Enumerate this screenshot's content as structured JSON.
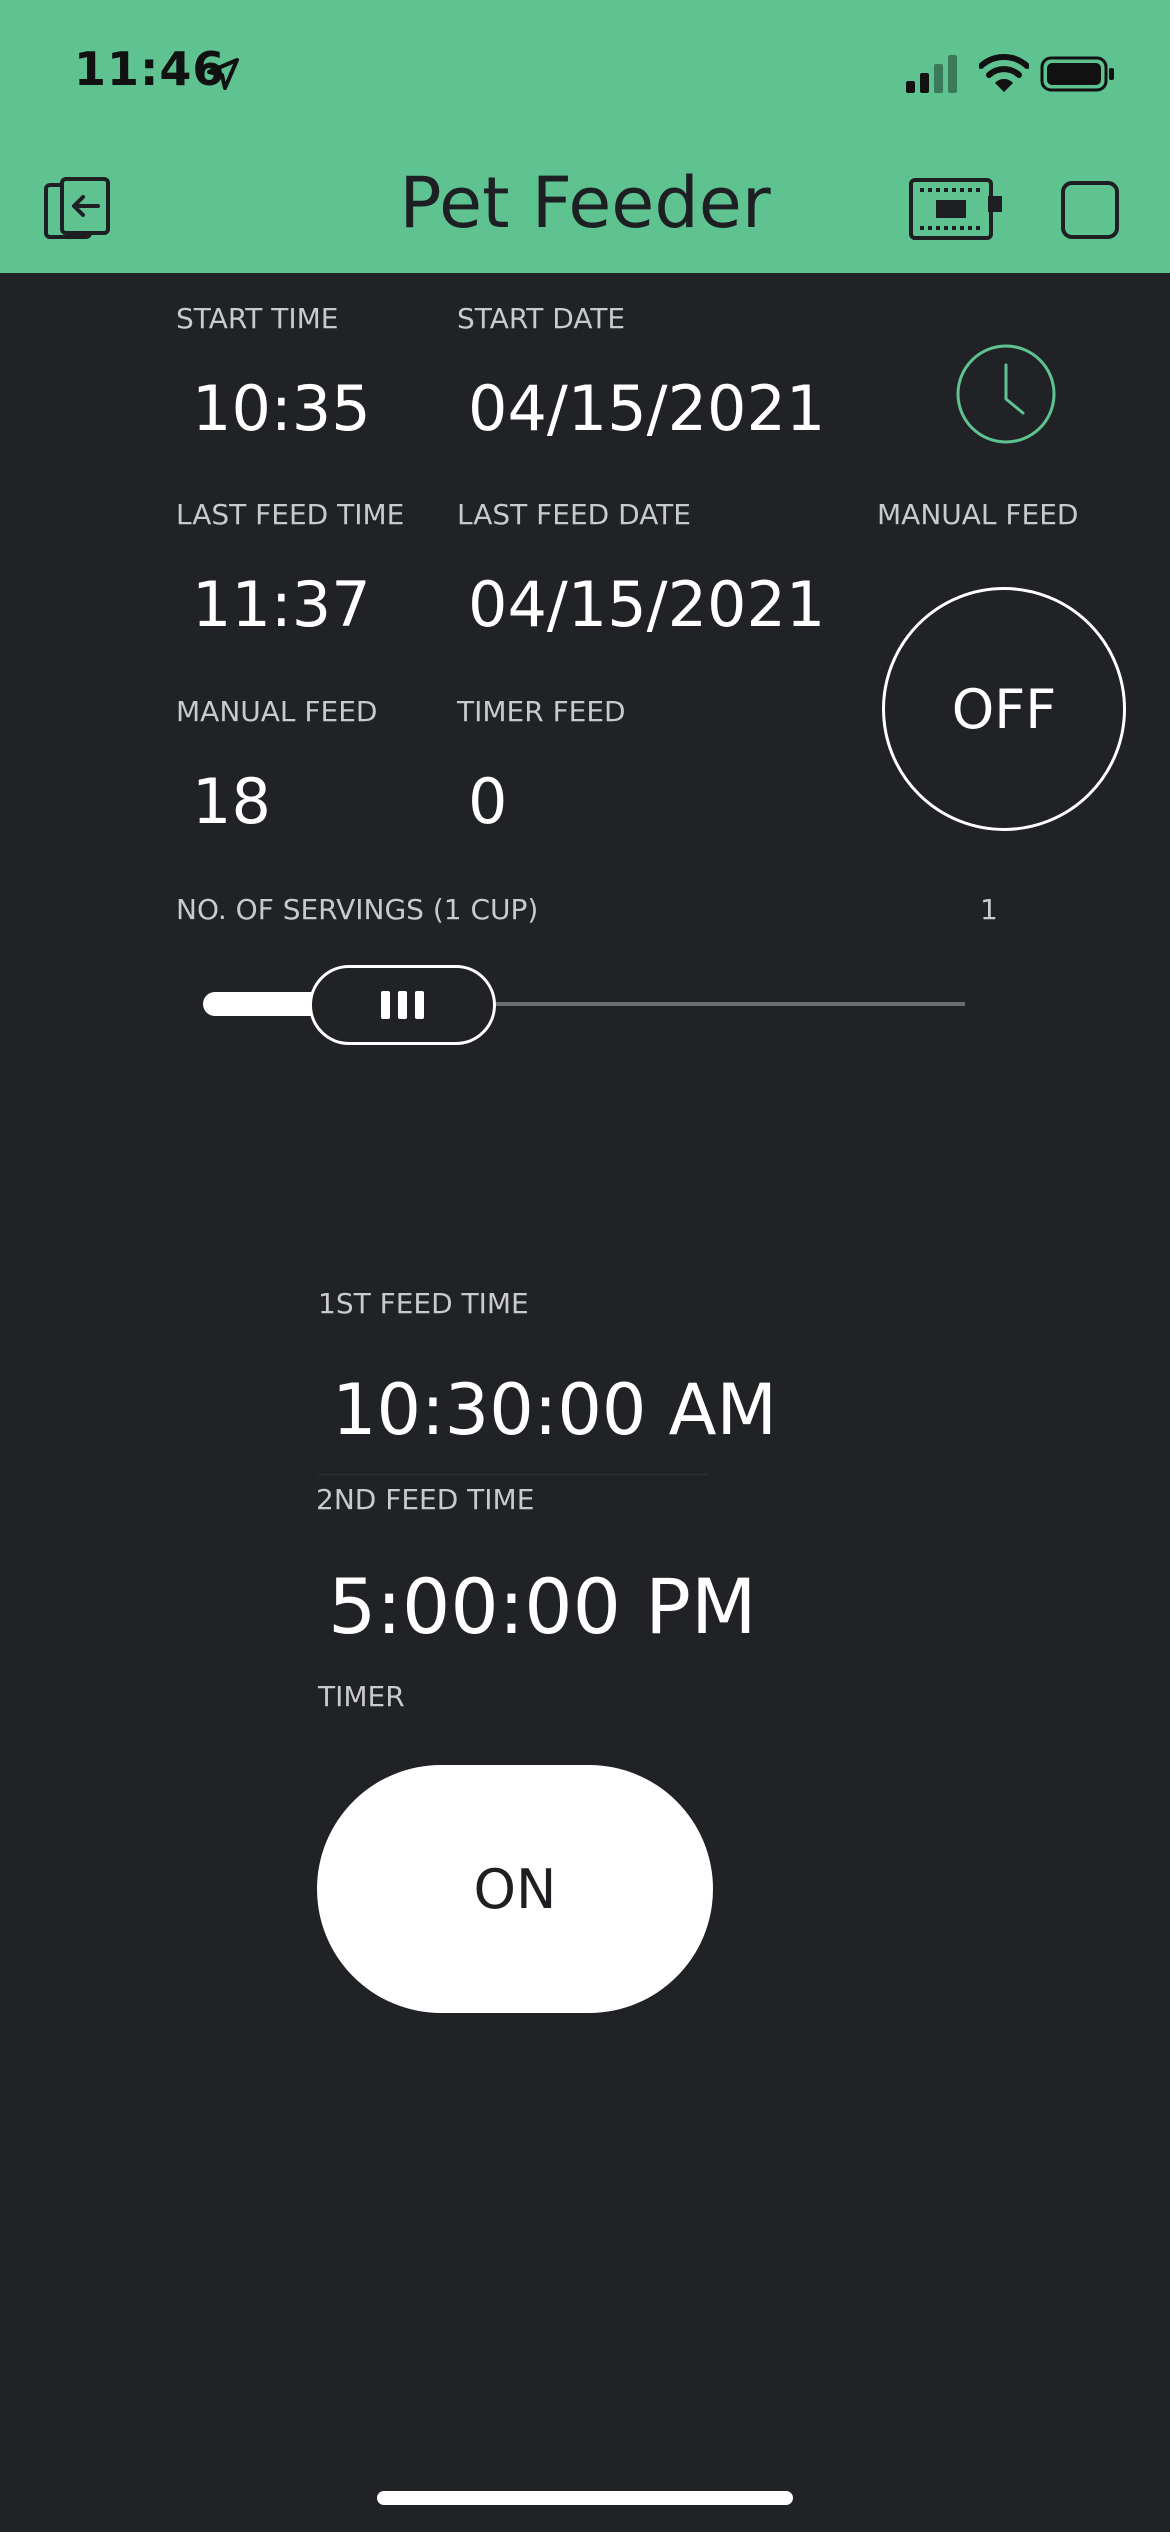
{
  "status_bar": {
    "time": "11:46"
  },
  "header": {
    "title": "Pet Feeder"
  },
  "stats": {
    "start_time_label": "START TIME",
    "start_time": "10:35",
    "start_date_label": "START DATE",
    "start_date": "04/15/2021",
    "last_feed_time_label": "LAST FEED TIME",
    "last_feed_time": "11:37",
    "last_feed_date_label": "LAST FEED DATE",
    "last_feed_date": "04/15/2021",
    "manual_feed_label": "MANUAL FEED",
    "manual_feed_count": "18",
    "timer_feed_label": "TIMER FEED",
    "timer_feed_count": "0"
  },
  "manual_feed_button": {
    "label": "MANUAL FEED",
    "state": "OFF"
  },
  "servings": {
    "label": "NO. OF SERVINGS (1 CUP)",
    "value": "1"
  },
  "schedule": {
    "first_label": "1ST FEED TIME",
    "first_time": "10:30:00 AM",
    "second_label": "2ND FEED TIME",
    "second_time": "5:00:00 PM"
  },
  "timer": {
    "label": "TIMER",
    "state": "ON"
  },
  "colors": {
    "accent": "#5ec291",
    "background": "#212226"
  }
}
